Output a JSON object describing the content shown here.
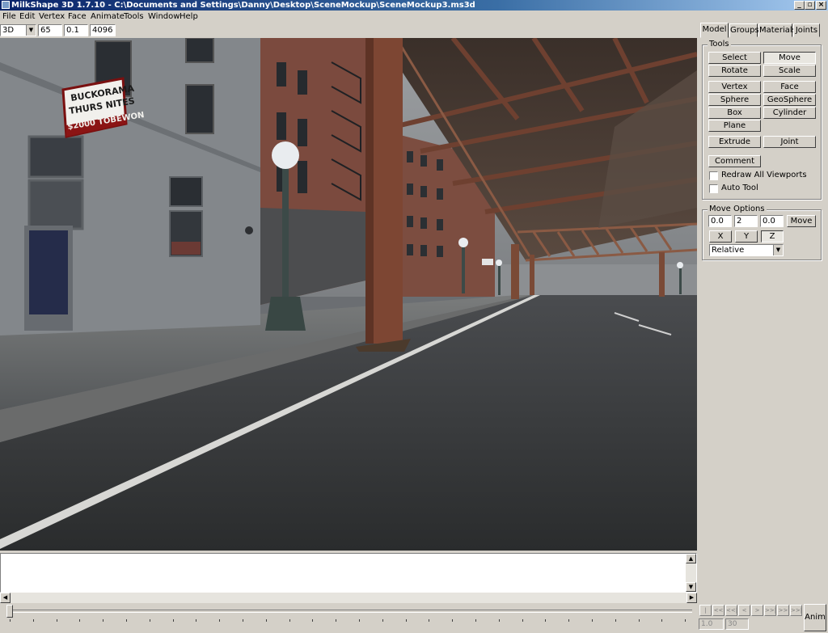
{
  "window": {
    "title": "MilkShape 3D 1.7.10 - C:\\Documents and Settings\\Danny\\Desktop\\SceneMockup\\SceneMockup3.ms3d",
    "minimize_glyph": "_",
    "maximize_glyph": "▫",
    "close_glyph": "×"
  },
  "menu": [
    "File",
    "Edit",
    "Vertex",
    "Face",
    "Animate",
    "Tools",
    "Window",
    "Help"
  ],
  "toolbar": {
    "view_mode": "3D",
    "fov": "65",
    "near_clip": "0.1",
    "far_clip": "4096"
  },
  "viewport": {
    "marquee_line1": "BUCKORAMA",
    "marquee_line2": "THURS NITES",
    "marquee_line3": "$2000 TOBEWON"
  },
  "panel": {
    "tabs": [
      {
        "label": "Model",
        "active": true
      },
      {
        "label": "Groups",
        "active": false
      },
      {
        "label": "Materials",
        "active": false
      },
      {
        "label": "Joints",
        "active": false
      }
    ],
    "tools_label": "Tools",
    "tools": {
      "select": "Select",
      "move": "Move",
      "rotate": "Rotate",
      "scale": "Scale",
      "vertex": "Vertex",
      "face": "Face",
      "sphere": "Sphere",
      "geosphere": "GeoSphere",
      "box": "Box",
      "cylinder": "Cylinder",
      "plane": "Plane",
      "extrude": "Extrude",
      "joint": "Joint",
      "comment": "Comment"
    },
    "active_tool": "Move",
    "redraw_all_label": "Redraw All Viewports",
    "redraw_all_checked": false,
    "auto_tool_label": "Auto Tool",
    "auto_tool_checked": false,
    "move_options_label": "Move Options",
    "move_x": "0.0",
    "move_y": "2",
    "move_z": "0.0",
    "move_button": "Move",
    "axis_x": "X",
    "axis_y": "Y",
    "axis_z": "Z",
    "mode": "Relative"
  },
  "playback": {
    "buttons": [
      "|<<",
      "<<",
      "<<|",
      "<",
      ">",
      ">>|",
      ">>",
      ">>|"
    ],
    "start_frame": "1.0",
    "end_frame": "30",
    "anim_button": "Anim"
  }
}
